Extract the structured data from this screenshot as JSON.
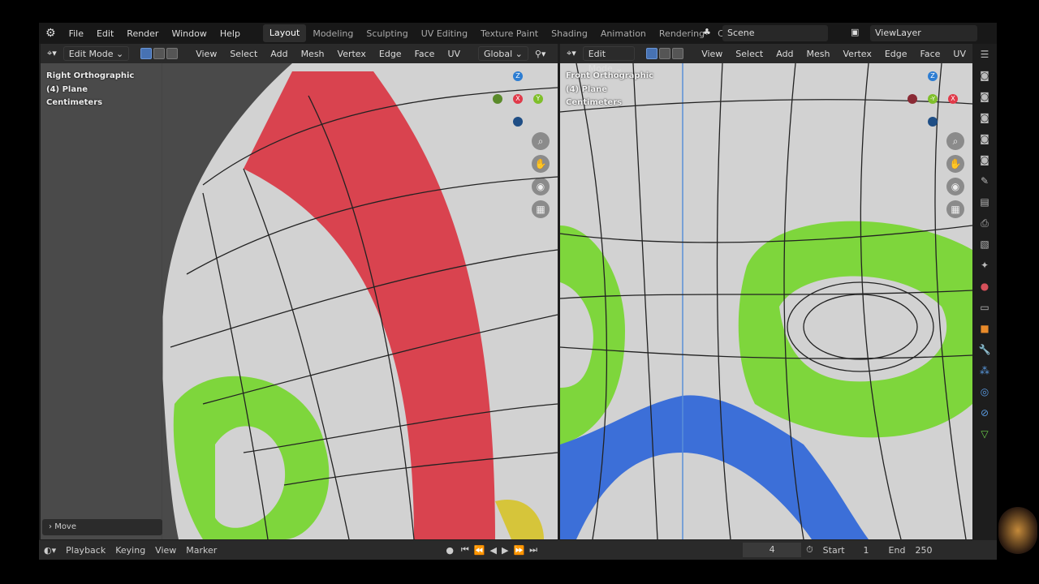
{
  "menu": [
    "File",
    "Edit",
    "Render",
    "Window",
    "Help"
  ],
  "workspaces": [
    "Layout",
    "Modeling",
    "Sculpting",
    "UV Editing",
    "Texture Paint",
    "Shading",
    "Animation",
    "Rendering",
    "Compo"
  ],
  "active_workspace": "Layout",
  "scene": "Scene",
  "view_layer": "ViewLayer",
  "left_view": {
    "mode": "Edit Mode",
    "menus": [
      "View",
      "Select",
      "Add",
      "Mesh",
      "Vertex",
      "Edge",
      "Face",
      "UV"
    ],
    "orientation": "Global",
    "overlay": [
      "Right Orthographic",
      "(4) Plane",
      "Centimeters"
    ],
    "gizmo": [
      "Z",
      "X",
      "Y"
    ]
  },
  "right_view": {
    "mode": "Edit Mode",
    "menus": [
      "View",
      "Select",
      "Add",
      "Mesh",
      "Vertex",
      "Edge",
      "Face",
      "UV"
    ],
    "overlay": [
      "Front Orthographic",
      "(4) Plane",
      "Centimeters"
    ],
    "gizmo": [
      "Z",
      "-Y",
      "X"
    ]
  },
  "last_op": "Move",
  "timeline": {
    "menus": [
      "Playback",
      "Keying",
      "View",
      "Marker"
    ],
    "current_frame": "4",
    "start_label": "Start",
    "start": "1",
    "end_label": "End",
    "end": "250"
  },
  "colors": {
    "red": "#d9434f",
    "green": "#7ed63c",
    "blue": "#3c6fd8",
    "mesh_bg": "#d2d2d2",
    "grid": "#b9b9b9"
  }
}
